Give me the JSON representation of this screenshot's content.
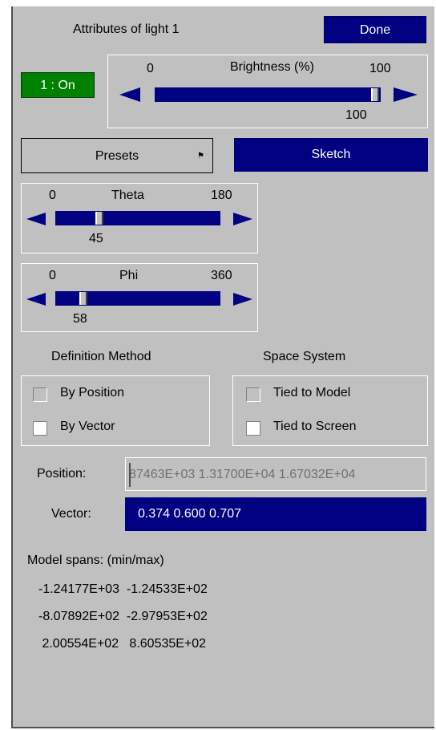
{
  "header": {
    "title": "Attributes of light 1",
    "done_label": "Done"
  },
  "light_toggle": {
    "label": "1 : On",
    "color": "#008000"
  },
  "brightness": {
    "label": "Brightness (%)",
    "min": "0",
    "max": "100",
    "value": "100",
    "fraction": 1.0
  },
  "presets_label": "Presets",
  "sketch_label": "Sketch",
  "theta": {
    "label": "Theta",
    "min": "0",
    "max": "180",
    "value": "45",
    "fraction": 0.25
  },
  "phi": {
    "label": "Phi",
    "min": "0",
    "max": "360",
    "value": "58",
    "fraction": 0.161
  },
  "definition": {
    "heading": "Definition Method",
    "options": [
      {
        "label": "By Position",
        "checked": false
      },
      {
        "label": "By Vector",
        "checked": true
      }
    ]
  },
  "space": {
    "heading": "Space System",
    "options": [
      {
        "label": "Tied to Model",
        "checked": false
      },
      {
        "label": "Tied to Screen",
        "checked": true
      }
    ]
  },
  "position": {
    "label": "Position:",
    "value": "87463E+03  1.31700E+04  1.67032E+04"
  },
  "vector": {
    "label": "Vector:",
    "value": "0.374  0.600  0.707"
  },
  "model_spans": {
    "heading": "Model spans: (min/max)",
    "rows": [
      "-1.24177E+03  -1.24533E+02",
      "-8.07892E+02  -2.97953E+02",
      " 2.00554E+02   8.60535E+02"
    ]
  },
  "colors": {
    "navy": "#000080",
    "panel": "#c0c0c0",
    "green": "#008000"
  }
}
